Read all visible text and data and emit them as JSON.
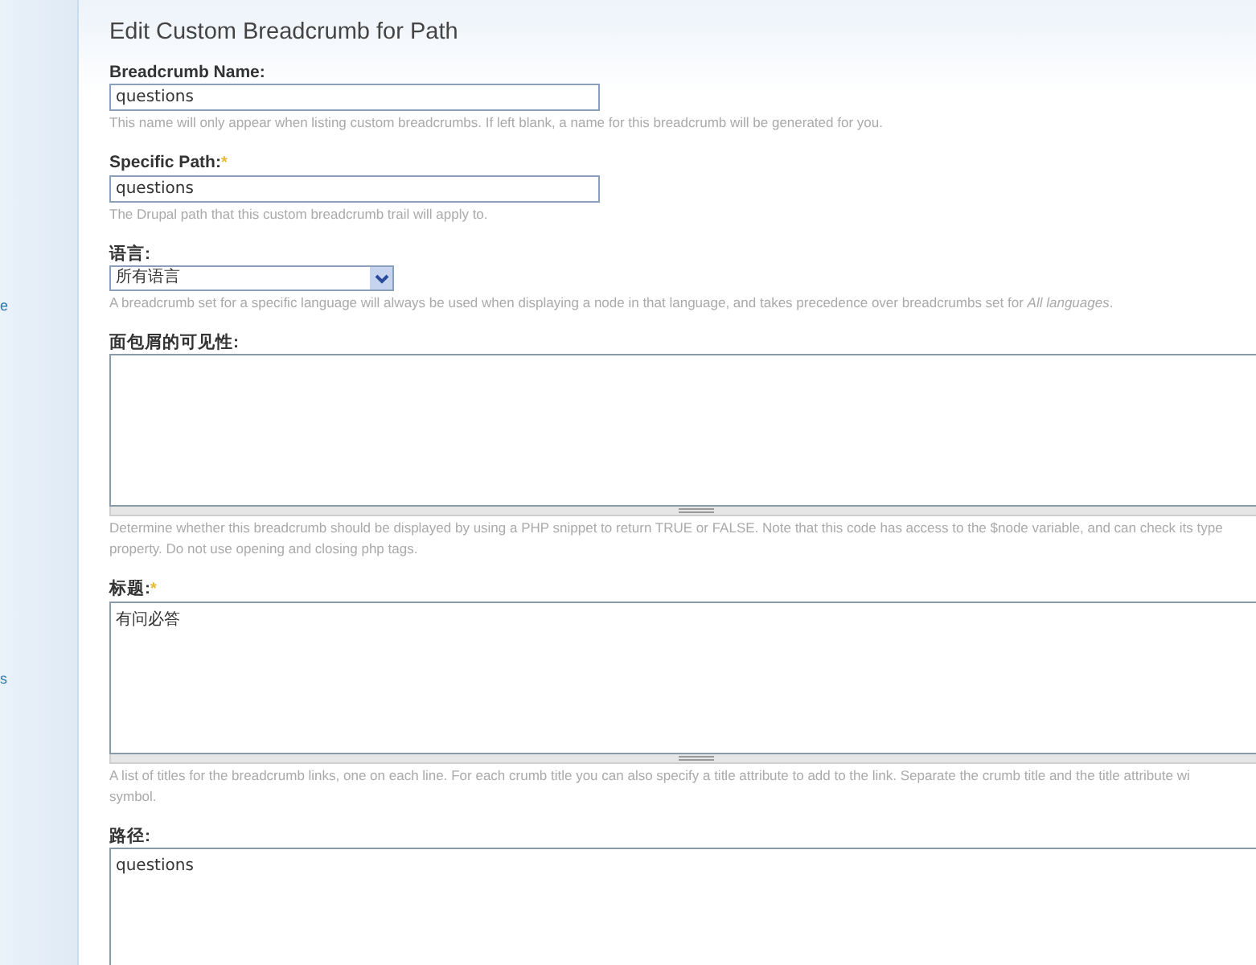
{
  "sidebar": {
    "fragments": [
      {
        "text": "e"
      },
      {
        "text": "s"
      }
    ]
  },
  "title": "Edit Custom Breadcrumb for Path",
  "fields": [
    {
      "kind": "text",
      "label": "Breadcrumb Name:",
      "value": "questions",
      "description": [
        "This name will only appear when listing custom breadcrumbs. If left blank, a name for this breadcrumb will be generated for you."
      ]
    },
    {
      "kind": "text",
      "label": "Specific Path:",
      "required_mark": "*",
      "value": "questions",
      "description": [
        "The Drupal path that this custom breadcrumb trail will apply to."
      ]
    },
    {
      "kind": "select",
      "label": "语言:",
      "value": "所有语言",
      "description": [
        "A breadcrumb set for a specific language will always be used when displaying a node in that language, and takes precedence over breadcrumbs set for *All languages*."
      ]
    },
    {
      "kind": "textarea",
      "label": "面包屑的可见性:",
      "description": [
        "Determine whether this breadcrumb should be displayed by using a PHP snippet to return TRUE or FALSE. Note that this code has access to the $node variable, and can check its type",
        "property. Do not use opening and closing php tags."
      ]
    },
    {
      "kind": "textarea",
      "label": "标题:",
      "required_mark": "*",
      "value": "有问必答",
      "description": [
        "A list of titles for the breadcrumb links, one on each line. For each crumb title you can also specify a title attribute to add to the link. Separate the crumb title and the title attribute wi",
        "symbol."
      ]
    },
    {
      "kind": "textarea",
      "label": "路径:",
      "value": "questions"
    }
  ]
}
